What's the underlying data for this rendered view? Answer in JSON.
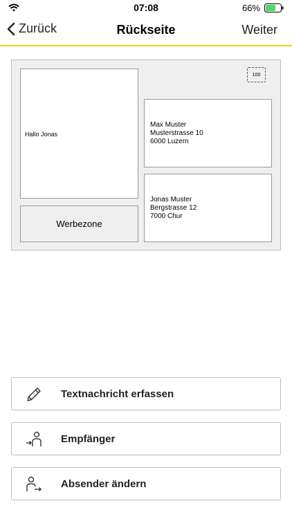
{
  "status": {
    "time": "07:08",
    "battery": "66%",
    "battery_level": 0.66,
    "battery_color": "#4cd964"
  },
  "nav": {
    "back_label": "Zurück",
    "title": "Rückseite",
    "next_label": "Weiter",
    "accent_color": "#f5d200"
  },
  "postcard": {
    "message": "Hallo Jonas",
    "ad_zone_label": "Werbezone",
    "stamp_value": "100",
    "sender": {
      "name": "Max Muster",
      "street": "Musterstrasse 10",
      "city": "6000 Luzern"
    },
    "recipient": {
      "name": "Jonas Muster",
      "street": "Bergstrasse 12",
      "city": "7000 Chur"
    }
  },
  "actions": [
    {
      "label": "Textnachricht erfassen",
      "icon": "pencil-icon"
    },
    {
      "label": "Empfänger",
      "icon": "recipient-icon"
    },
    {
      "label": "Absender ändern",
      "icon": "sender-icon"
    }
  ]
}
